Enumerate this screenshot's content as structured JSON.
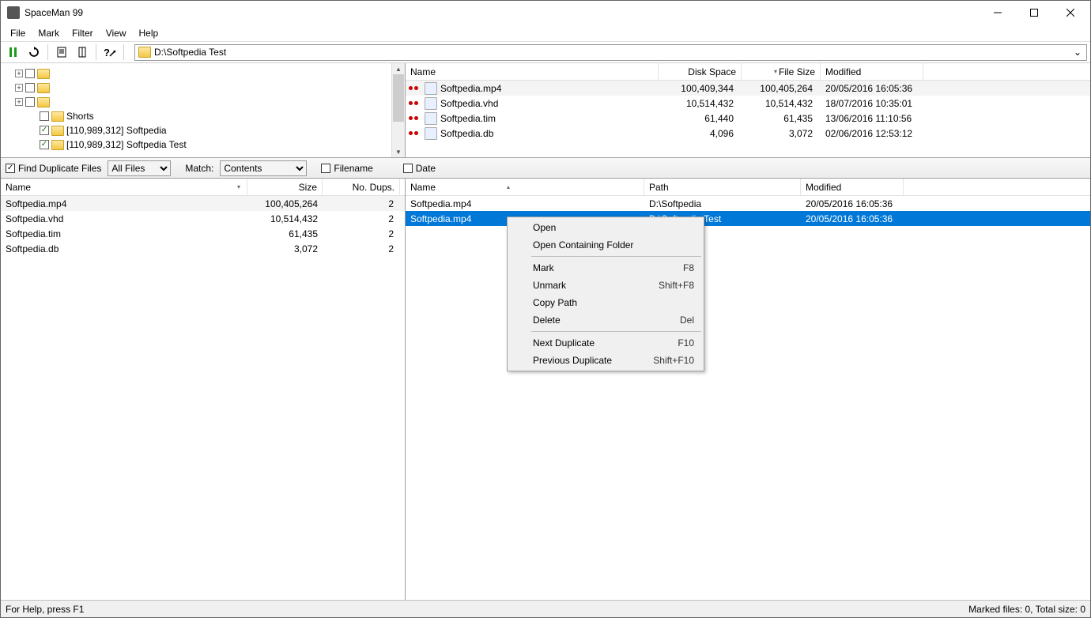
{
  "title": "SpaceMan 99",
  "menus": {
    "file": "File",
    "mark": "Mark",
    "filter": "Filter",
    "view": "View",
    "help": "Help"
  },
  "path": "D:\\Softpedia Test",
  "tree": [
    {
      "expander": "+",
      "checked": false,
      "label": "",
      "indent": 0
    },
    {
      "expander": "+",
      "checked": false,
      "label": "",
      "indent": 0
    },
    {
      "expander": "+",
      "checked": false,
      "label": "",
      "indent": 0
    },
    {
      "expander": "",
      "checked": false,
      "label": "Shorts",
      "indent": 1
    },
    {
      "expander": "",
      "checked": true,
      "label": "[110,989,312] Softpedia",
      "indent": 1
    },
    {
      "expander": "",
      "checked": true,
      "label": "[110,989,312] Softpedia Test",
      "indent": 1
    }
  ],
  "fileCols": {
    "name": "Name",
    "disk": "Disk Space",
    "fsize": "File Size",
    "mod": "Modified"
  },
  "files": [
    {
      "name": "Softpedia.mp4",
      "disk": "100,409,344",
      "fsize": "100,405,264",
      "mod": "20/05/2016 16:05:36"
    },
    {
      "name": "Softpedia.vhd",
      "disk": "10,514,432",
      "fsize": "10,514,432",
      "mod": "18/07/2016 10:35:01"
    },
    {
      "name": "Softpedia.tim",
      "disk": "61,440",
      "fsize": "61,435",
      "mod": "13/06/2016 11:10:56"
    },
    {
      "name": "Softpedia.db",
      "disk": "4,096",
      "fsize": "3,072",
      "mod": "02/06/2016 12:53:12"
    }
  ],
  "mid": {
    "findDup": "Find Duplicate Files",
    "allFiles": "All Files",
    "match": "Match:",
    "contents": "Contents",
    "filename": "Filename",
    "date": "Date"
  },
  "dupCols": {
    "name": "Name",
    "size": "Size",
    "nod": "No. Dups."
  },
  "dups": [
    {
      "name": "Softpedia.mp4",
      "size": "100,405,264",
      "n": "2"
    },
    {
      "name": "Softpedia.vhd",
      "size": "10,514,432",
      "n": "2"
    },
    {
      "name": "Softpedia.tim",
      "size": "61,435",
      "n": "2"
    },
    {
      "name": "Softpedia.db",
      "size": "3,072",
      "n": "2"
    }
  ],
  "pathCols": {
    "name": "Name",
    "path": "Path",
    "mod": "Modified"
  },
  "paths": [
    {
      "name": "Softpedia.mp4",
      "path": "D:\\Softpedia",
      "mod": "20/05/2016 16:05:36",
      "sel": false
    },
    {
      "name": "Softpedia.mp4",
      "path": "D:\\Softpedia Test",
      "mod": "20/05/2016 16:05:36",
      "sel": true
    }
  ],
  "ctx": [
    {
      "t": "Open",
      "s": ""
    },
    {
      "t": "Open Containing Folder",
      "s": ""
    },
    {
      "sep": true
    },
    {
      "t": "Mark",
      "s": "F8"
    },
    {
      "t": "Unmark",
      "s": "Shift+F8"
    },
    {
      "t": "Copy Path",
      "s": ""
    },
    {
      "t": "Delete",
      "s": "Del"
    },
    {
      "sep": true
    },
    {
      "t": "Next Duplicate",
      "s": "F10"
    },
    {
      "t": "Previous Duplicate",
      "s": "Shift+F10"
    }
  ],
  "status": {
    "left": "For Help, press F1",
    "right": "Marked files: 0,  Total size: 0"
  }
}
